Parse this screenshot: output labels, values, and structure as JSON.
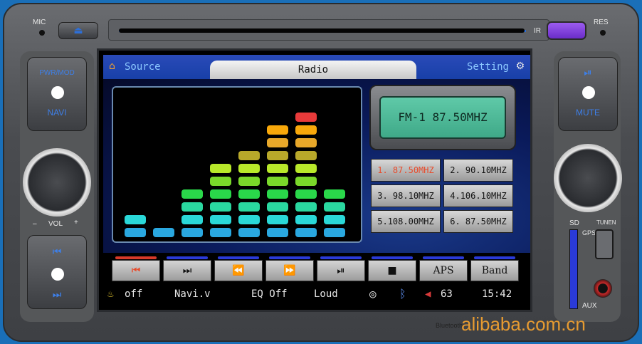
{
  "labels": {
    "mic": "MIC",
    "ir": "IR",
    "res": "RES",
    "pwr_mod": "PWR/MOD",
    "navi": "NAVI",
    "vol": "VOL",
    "vol_minus": "–",
    "vol_plus": "+",
    "mute": "MUTE",
    "sd": "SD",
    "gps": "GPS",
    "tunen": "TUNEN",
    "aux": "AUX"
  },
  "screen": {
    "source_label": "Source",
    "tab_label": "Radio",
    "setting_label": "Setting",
    "lcd_text": "FM-1   87.50MHZ",
    "presets": [
      {
        "label": "1. 87.50MHZ",
        "active": true
      },
      {
        "label": "2. 90.10MHZ",
        "active": false
      },
      {
        "label": "3. 98.10MHZ",
        "active": false
      },
      {
        "label": "4.106.10MHZ",
        "active": false
      },
      {
        "label": "5.108.00MHZ",
        "active": false
      },
      {
        "label": "6. 87.50MHZ",
        "active": false
      }
    ],
    "controls": [
      {
        "name": "prev-track",
        "label": "⏮"
      },
      {
        "name": "next-track",
        "label": "⏭"
      },
      {
        "name": "rewind",
        "label": "⏪"
      },
      {
        "name": "fast-forward",
        "label": "⏩"
      },
      {
        "name": "play-pause",
        "label": "⏯"
      },
      {
        "name": "stop",
        "label": "■"
      },
      {
        "name": "aps",
        "label": "APS"
      },
      {
        "name": "band",
        "label": "Band"
      }
    ],
    "status": {
      "seat_state": "off",
      "navi": "Navi.v",
      "eq": "EQ Off",
      "loud": "Loud",
      "volume": "63",
      "time": "15:42"
    },
    "eq_levels": [
      2,
      1,
      4,
      6,
      7,
      9,
      10,
      4
    ],
    "eq_colors": [
      "#2aa8e0",
      "#2ad8d8",
      "#2ad8a0",
      "#2ad84a",
      "#7ad82a",
      "#b8e82a",
      "#b8a82a",
      "#e8a82a",
      "#f8a80a",
      "#e83a3a"
    ]
  },
  "footer": {
    "bluetooth": "Bluetooth",
    "watermark": "alibaba.com.cn"
  }
}
